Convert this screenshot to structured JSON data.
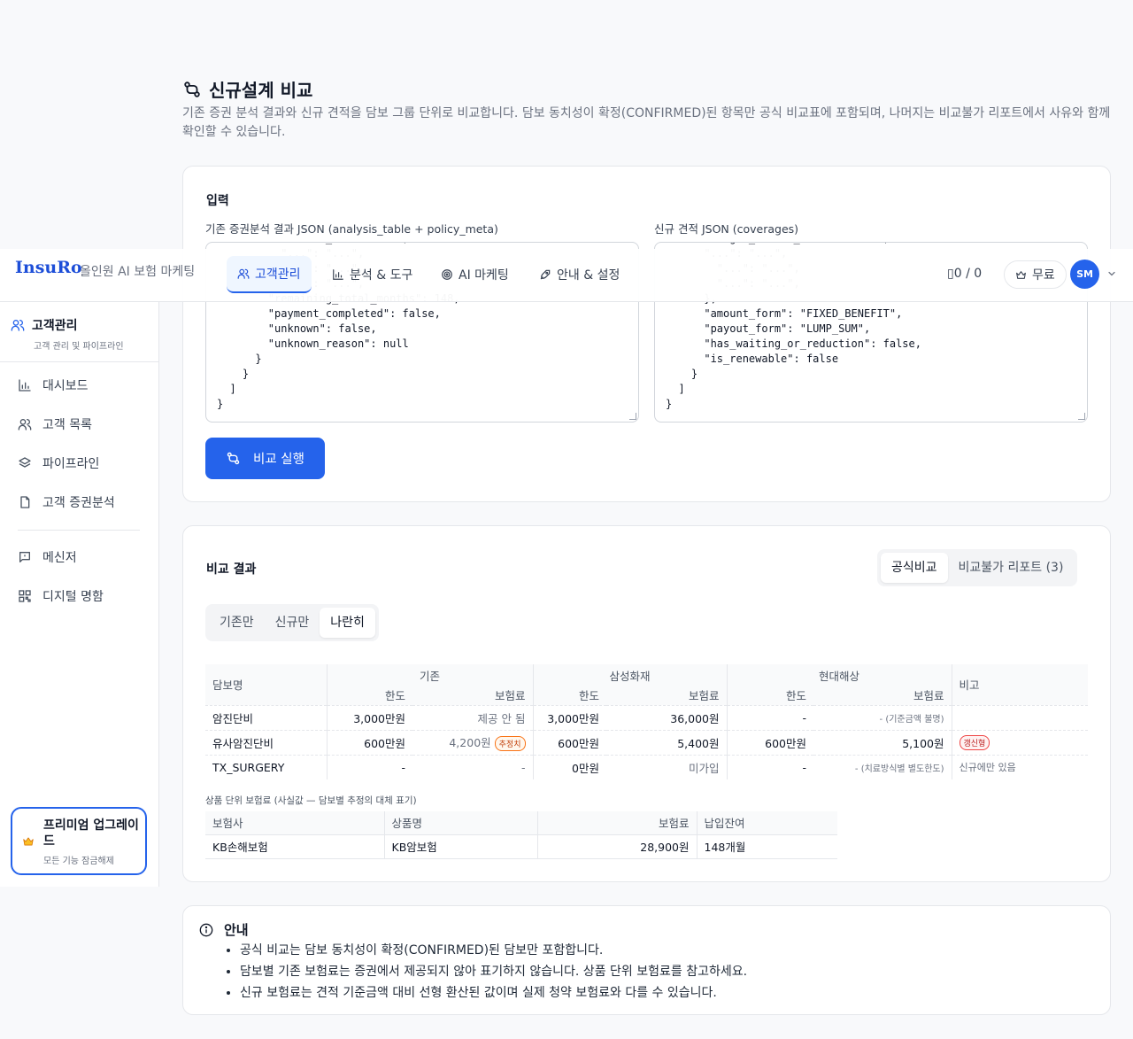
{
  "page": {
    "title": "신규설계 비교",
    "description": "기존 증권 분석 결과와 신규 견적을 담보 그룹 단위로 비교합니다. 담보 동치성이 확정(CONFIRMED)된 항목만 공식 비교표에 포함되며, 나머지는 비교불가 리포트에서 사유와 함께 확인할 수 있습니다."
  },
  "input": {
    "heading": "입력",
    "existing_label": "기존 증권분석 결과 JSON (analysis_table + policy_meta)",
    "new_label": "신규 견적 JSON (coverages)",
    "existing_json": "          \"column_id\": \"col0\",\n          \"...\": \"...\",\n          \"...\": \"...\",\n          \"...\": \"...\",\n        \"remaining_total_months\": 148,\n        \"payment_completed\": false,\n        \"unknown\": false,\n        \"unknown_reason\": null\n      }\n    }\n  ]\n}",
    "new_json": "      \"target_amount_manwon\": 3000,\n      \"...\": \"...\",\n        \"...\": \"...\",\n        \"...\": \"...\",\n      },\n      \"amount_form\": \"FIXED_BENEFIT\",\n      \"payout_form\": \"LUMP_SUM\",\n      \"has_waiting_or_reduction\": false,\n      \"is_renewable\": false\n    }\n  ]\n}",
    "run_label": "비교 실행"
  },
  "result": {
    "heading": "비교 결과",
    "mode_tabs": [
      {
        "label": "공식비교",
        "active": true
      },
      {
        "label": "비교불가 리포트 (3)",
        "active": false
      }
    ],
    "view_tabs": [
      {
        "label": "기존만",
        "active": false
      },
      {
        "label": "신규만",
        "active": false
      },
      {
        "label": "나란히",
        "active": true
      }
    ],
    "table": {
      "col_name": "담보명",
      "groups": [
        "기존",
        "삼성화재",
        "현대해상"
      ],
      "col_limit": "한도",
      "col_premium": "보험료",
      "col_note": "비고",
      "rows": [
        {
          "name": "암진단비",
          "e_limit": "3,000만원",
          "e_premium": "제공 안 됨",
          "e_badge": "",
          "s_limit": "3,000만원",
          "s_premium": "36,000원",
          "h_limit": "-",
          "h_premium": "- (기준금액 불명)",
          "note": "",
          "note_badge": ""
        },
        {
          "name": "유사암진단비",
          "e_limit": "600만원",
          "e_premium": "4,200원",
          "e_badge": "추정치",
          "s_limit": "600만원",
          "s_premium": "5,400원",
          "h_limit": "600만원",
          "h_premium": "5,100원",
          "note": "",
          "note_badge": "갱신형"
        },
        {
          "name": "TX_SURGERY",
          "e_limit": "-",
          "e_premium": "-",
          "e_badge": "",
          "s_limit": "0만원",
          "s_premium": "미가입",
          "h_limit": "-",
          "h_premium": "- (치료방식별 별도한도)",
          "note": "신규에만 있음",
          "note_badge": ""
        }
      ]
    },
    "product": {
      "caption": "상품 단위 보험료 (사실값 — 담보별 추정의 대체 표기)",
      "headers": [
        "보험사",
        "상품명",
        "보험료",
        "납입잔여"
      ],
      "rows": [
        {
          "insurer": "KB손해보험",
          "product": "KB암보험",
          "premium": "28,900원",
          "remaining": "148개월"
        }
      ]
    }
  },
  "info": {
    "title": "안내",
    "items": [
      "공식 비교는 담보 동치성이 확정(CONFIRMED)된 담보만 포함합니다.",
      "담보별 기존 보험료는 증권에서 제공되지 않아 표기하지 않습니다. 상품 단위 보험료를 참고하세요.",
      "신규 보험료는 견적 기준금액 대비 선형 환산된 값이며 실제 청약 보험료와 다를 수 있습니다."
    ]
  },
  "nav": {
    "logo": "InsuRo",
    "subtitle": "올인원 AI 보험 마케팅",
    "tabs": [
      {
        "label": "고객관리",
        "active": true,
        "icon": "users-icon"
      },
      {
        "label": "분석 & 도구",
        "active": false,
        "icon": "bar-chart-icon"
      },
      {
        "label": "AI 마케팅",
        "active": false,
        "icon": "target-icon"
      },
      {
        "label": "안내 & 설정",
        "active": false,
        "icon": "rocket-icon"
      }
    ],
    "credits": "0 / 0",
    "plan": "무료",
    "avatar": "SM"
  },
  "sidebar": {
    "title": "고객관리",
    "subtitle": "고객 관리 및 파이프라인",
    "items": [
      {
        "label": "대시보드",
        "icon": "bar-chart-icon"
      },
      {
        "label": "고객 목록",
        "icon": "users-icon"
      },
      {
        "label": "파이프라인",
        "icon": "layers-icon"
      },
      {
        "label": "고객 증권분석",
        "icon": "file-icon"
      },
      {
        "label": "메신저",
        "icon": "message-icon"
      },
      {
        "label": "디지털 명함",
        "icon": "qr-icon"
      }
    ],
    "premium_title": "프리미엄 업그레이드",
    "premium_sub": "모든 기능 잠금해제"
  },
  "colors": {
    "accent": "#2563eb",
    "accent_dark": "#1d4ed8",
    "badge_orange": "#f97316",
    "badge_red": "#ef4444"
  }
}
